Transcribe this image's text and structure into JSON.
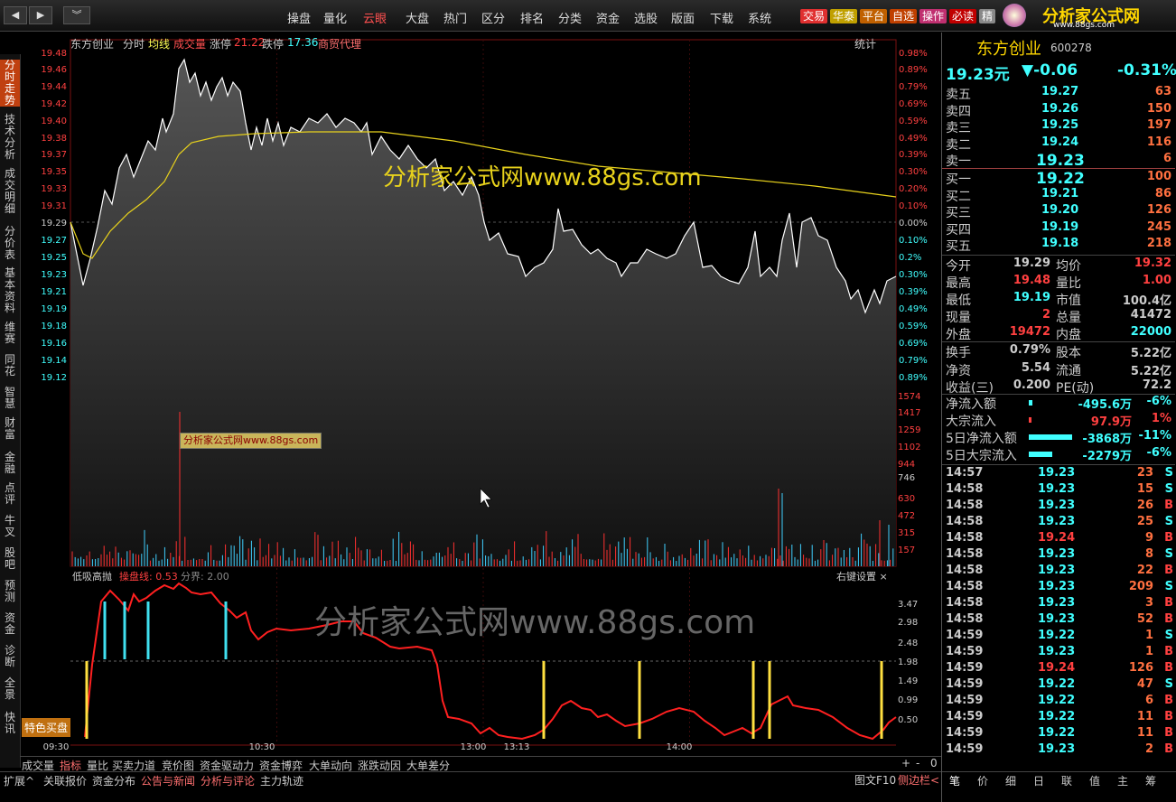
{
  "topbar": {
    "menu": [
      "操盘",
      "量化",
      "云眼",
      "大盘",
      "热门",
      "区分",
      "排名",
      "分类",
      "资金",
      "选股",
      "版面",
      "下载",
      "系统"
    ],
    "tags": [
      "交易",
      "华泰",
      "平台",
      "自选",
      "操作",
      "必读",
      "精"
    ],
    "brand": "分析家公式网",
    "brand_url": "www.88gs.com"
  },
  "lefttabs": [
    "分时走势",
    "技术分析",
    "成交明细",
    "分价表",
    "基本资料",
    "维赛",
    "同花",
    "智慧",
    "财富",
    "金融",
    "点评",
    "牛叉",
    "股吧",
    "预测",
    "资金",
    "诊断",
    "全景",
    "快讯"
  ],
  "chart": {
    "header": {
      "name": "东方创业",
      "items": [
        "分时",
        "均线",
        "成交量"
      ],
      "up_label": "涨停",
      "up_value": "21.22",
      "down_label": "跌停",
      "down_value": "17.36",
      "sector": "商贸代理",
      "stat": "统计"
    },
    "price_ticks": [
      "19.48",
      "19.46",
      "19.44",
      "19.42",
      "19.40",
      "19.38",
      "19.37",
      "19.35",
      "19.33",
      "19.31",
      "19.29",
      "19.27",
      "19.25",
      "19.23",
      "19.21",
      "19.19",
      "19.18",
      "19.16",
      "19.14",
      "19.12"
    ],
    "pct_ticks": [
      "0.98%",
      "0.89%",
      "0.79%",
      "0.69%",
      "0.59%",
      "0.49%",
      "0.39%",
      "0.30%",
      "0.20%",
      "0.10%",
      "0.00%",
      "0.10%",
      "0.2%",
      "0.30%",
      "0.39%",
      "0.49%",
      "0.59%",
      "0.69%",
      "0.79%",
      "0.89%"
    ],
    "vol_ticks": [
      "1574",
      "1417",
      "1259",
      "1102",
      "944",
      "746",
      "630",
      "472",
      "315",
      "157"
    ],
    "watermark": "分析家公式网www.88gs.com",
    "small_watermark": "分析家公式网www.88gs.com",
    "indicator": {
      "name": "低吸高抛",
      "line_label": "操盘线: 0.53",
      "bound_label": "分界: 2.00",
      "settings": "右键设置 ×",
      "ticks": [
        "3.47",
        "2.98",
        "2.48",
        "1.98",
        "1.49",
        "0.99",
        "0.50"
      ]
    },
    "indicator_watermark": "分析家公式网www.88gs.com",
    "special_btn": "特色买盘",
    "time_ticks": [
      "09:30",
      "10:30",
      "13:00",
      "13:13",
      "14:00"
    ],
    "subtabs": [
      "成交量",
      "指标",
      "量比",
      "买卖力道",
      "竞价图",
      "资金驱动力",
      "资金博弈",
      "大单动向",
      "涨跌动因",
      "大单差分"
    ],
    "bottomtabs": [
      "扩展^",
      "关联报价",
      "资金分布",
      "公告与新闻",
      "分析与评论",
      "主力轨迹"
    ],
    "bottom_right": [
      "图文F10",
      "侧边栏<"
    ],
    "zoom": [
      "+",
      "-",
      "0"
    ]
  },
  "right": {
    "name": "东方创业",
    "code": "600278",
    "price": "19.23元",
    "change": "▼-0.06",
    "change_pct": "-0.31%",
    "asks": [
      [
        "卖五",
        "19.27",
        "63"
      ],
      [
        "卖四",
        "19.26",
        "150"
      ],
      [
        "卖三",
        "19.25",
        "197"
      ],
      [
        "卖二",
        "19.24",
        "116"
      ],
      [
        "卖一",
        "19.23",
        "6"
      ]
    ],
    "bids": [
      [
        "买一",
        "19.22",
        "100"
      ],
      [
        "买二",
        "19.21",
        "86"
      ],
      [
        "买三",
        "19.20",
        "126"
      ],
      [
        "买四",
        "19.19",
        "245"
      ],
      [
        "买五",
        "19.18",
        "218"
      ]
    ],
    "stats": [
      [
        "今开",
        "19.29",
        "均价",
        "19.32"
      ],
      [
        "最高",
        "19.48",
        "量比",
        "1.00"
      ],
      [
        "最低",
        "19.19",
        "市值",
        "100.4亿"
      ],
      [
        "现量",
        "2",
        "总量",
        "41472"
      ],
      [
        "外盘",
        "19472",
        "内盘",
        "22000"
      ],
      [
        "换手",
        "0.79%",
        "股本",
        "5.22亿"
      ],
      [
        "净资",
        "5.54",
        "流通",
        "5.22亿"
      ],
      [
        "收益(三)",
        "0.200",
        "PE(动)",
        "72.2"
      ]
    ],
    "flows": [
      [
        "净流入额",
        "-495.6万",
        "-6%"
      ],
      [
        "大宗流入",
        "97.9万",
        "1%"
      ],
      [
        "5日净流入额",
        "-3868万",
        "-11%"
      ],
      [
        "5日大宗流入",
        "-2279万",
        "-6%"
      ]
    ],
    "ticks": [
      [
        "14:57",
        "19.23",
        "23",
        "S"
      ],
      [
        "14:58",
        "19.23",
        "15",
        "S"
      ],
      [
        "14:58",
        "19.23",
        "26",
        "B"
      ],
      [
        "14:58",
        "19.23",
        "25",
        "S"
      ],
      [
        "14:58",
        "19.24",
        "9",
        "B"
      ],
      [
        "14:58",
        "19.23",
        "8",
        "S"
      ],
      [
        "14:58",
        "19.23",
        "22",
        "B"
      ],
      [
        "14:58",
        "19.23",
        "209",
        "S"
      ],
      [
        "14:58",
        "19.23",
        "3",
        "B"
      ],
      [
        "14:58",
        "19.23",
        "52",
        "B"
      ],
      [
        "14:59",
        "19.22",
        "1",
        "S"
      ],
      [
        "14:59",
        "19.23",
        "1",
        "B"
      ],
      [
        "14:59",
        "19.24",
        "126",
        "B"
      ],
      [
        "14:59",
        "19.22",
        "47",
        "S"
      ],
      [
        "14:59",
        "19.22",
        "6",
        "B"
      ],
      [
        "14:59",
        "19.22",
        "11",
        "B"
      ],
      [
        "14:59",
        "19.22",
        "11",
        "B"
      ],
      [
        "14:59",
        "19.23",
        "2",
        "B"
      ]
    ],
    "tabs": [
      "笔",
      "价",
      "细",
      "日",
      "联",
      "值",
      "主",
      "筹"
    ]
  }
}
